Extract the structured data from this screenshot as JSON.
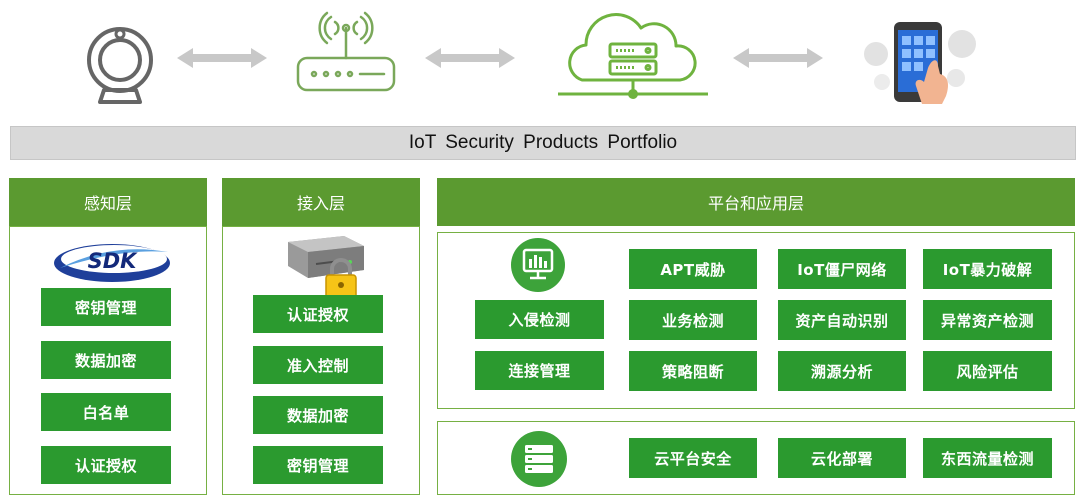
{
  "banner": {
    "title": "IoT  Security  Products Portfolio"
  },
  "icons": {
    "camera": "webcam-icon",
    "router": "wifi-router-icon",
    "cloud": "cloud-server-icon",
    "phone": "smartphone-app-icon",
    "arrows": "double-arrow-icon",
    "sdk": "sdk-logo-icon",
    "server": "locked-server-icon",
    "monitor": "monitor-chart-icon",
    "serverlist": "server-list-icon"
  },
  "perception": {
    "header": "感知层",
    "sdk_text": "SDK",
    "items": [
      "密钥管理",
      "数据加密",
      "白名单",
      "认证授权"
    ]
  },
  "access": {
    "header": "接入层",
    "items": [
      "认证授权",
      "准入控制",
      "数据加密",
      "密钥管理"
    ]
  },
  "platform": {
    "header": "平台和应用层",
    "upper": {
      "left_items": [
        "入侵检测",
        "连接管理"
      ],
      "grid": [
        [
          "APT威胁",
          "IoT僵尸网络",
          "IoT暴力破解"
        ],
        [
          "业务检测",
          "资产自动识别",
          "异常资产检测"
        ],
        [
          "策略阻断",
          "溯源分析",
          "风险评估"
        ]
      ]
    },
    "lower": {
      "items": [
        "云平台安全",
        "云化部署",
        "东西流量检测"
      ]
    }
  },
  "colors": {
    "header_green": "#5b9a30",
    "button_green": "#2b9a2f",
    "frame_green": "#76b043",
    "banner_gray": "#d9d9d9"
  }
}
